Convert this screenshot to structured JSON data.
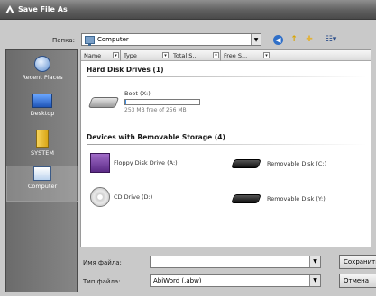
{
  "window": {
    "title": "Save File As"
  },
  "toolbar": {
    "lookin_label": "Папка:",
    "location": "Computer",
    "back_icon": "back-arrow-icon",
    "up_icon": "up-folder-icon",
    "new_folder_icon": "new-folder-icon",
    "view_icon": "view-menu-icon"
  },
  "sidebar": {
    "items": [
      {
        "label": "Recent Places",
        "icon": "recent-places-icon"
      },
      {
        "label": "Desktop",
        "icon": "desktop-icon"
      },
      {
        "label": "SYSTEM",
        "icon": "user-folder-icon"
      },
      {
        "label": "Computer",
        "icon": "computer-icon",
        "selected": true
      }
    ]
  },
  "columns": [
    "Name",
    "Type",
    "Total S...",
    "Free S..."
  ],
  "groups": {
    "hdd": "Hard Disk Drives (1)",
    "removable": "Devices with Removable Storage (4)"
  },
  "drives": {
    "boot": {
      "name": "Boot (X:)",
      "free_text": "253 MB free of 256 MB",
      "used_fraction": 0.012
    },
    "floppy": "Floppy Disk Drive (A:)",
    "removable_c": "Removable Disk (C:)",
    "cd": "CD Drive (D:)",
    "removable_y": "Removable Disk (Y:)"
  },
  "footer": {
    "filename_label": "Имя файла:",
    "filename_value": "",
    "filetype_label": "Тип файла:",
    "filetype_value": "AbiWord (.abw)",
    "save_button": "Сохранить",
    "cancel_button": "Отмена"
  },
  "colors": {
    "accent": "#2f6fc8",
    "sidebar": "#777777",
    "titlebar": "#5f5f5f"
  }
}
